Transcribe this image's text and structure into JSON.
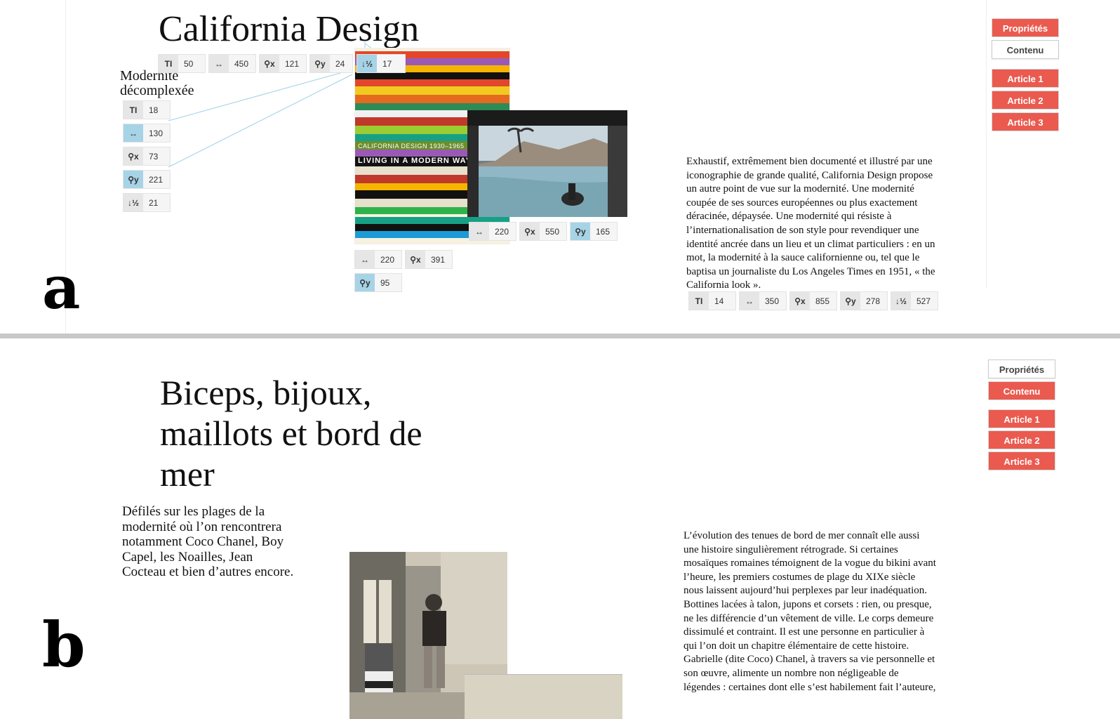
{
  "colors": {
    "accent": "#ea5a4f",
    "chip_active": "#a7d3e7"
  },
  "icons": {
    "size": "font-size-icon",
    "width": "width-icon",
    "x": "pin-x-icon",
    "y": "pin-y-icon",
    "z": "z-order-icon"
  },
  "panel_a": {
    "letter": "a",
    "title": "California Design",
    "subtitle_line1": "Modernité",
    "subtitle_line2": "décomplexée",
    "body": "Exhaustif, extrêmement bien documenté et illustré par une iconographie de grande qualité, California Design propose un autre point de vue sur la modernité. Une modernité coupée de ses sources européennes ou plus exactement déracinée, dépaysée. Une modernité qui résiste à l’internationalisation de son style pour revendiquer une identité ancrée dans un lieu et un climat particuliers : en un mot, la modernité à la sauce californienne ou, tel que le baptisa un journaliste du Los Angeles Times en 1951, « the California look ».",
    "book_text_line1": "CALIFORNIA DESIGN   1930–1965",
    "book_text_line2": "LIVING IN A MODERN WAY",
    "menu": {
      "proprietes": "Propriétés",
      "contenu": "Contenu",
      "article1": "Article 1",
      "article2": "Article 2",
      "article3": "Article 3"
    },
    "title_chips": {
      "size": "50",
      "width": "450",
      "x": "121",
      "y": "24",
      "z": "17"
    },
    "subtitle_chips": {
      "size": "18",
      "width": "130",
      "x": "73",
      "y": "221",
      "z": "21"
    },
    "photo_chips": {
      "width": "220",
      "x": "550",
      "y": "165"
    },
    "book_chips": {
      "width": "220",
      "x": "391",
      "y": "95"
    },
    "body_chips": {
      "size": "14",
      "width": "350",
      "x": "855",
      "y": "278",
      "z": "527"
    }
  },
  "panel_b": {
    "letter": "b",
    "title_line1": "Biceps, bijoux,",
    "title_line2": "maillots et bord de",
    "title_line3": "mer",
    "subtitle_line1": "Défilés sur les plages de la",
    "subtitle_line2": "modernité où l’on rencontrera",
    "subtitle_line3": "notamment Coco Chanel, Boy",
    "subtitle_line4": "Capel, les Noailles, Jean",
    "subtitle_line5": "Cocteau et bien d’autres encore.",
    "body": "L’évolution des tenues de bord de mer connaît elle aussi une histoire singulièrement rétrograde. Si certaines mosaïques romaines témoignent de la vogue du bikini avant l’heure, les premiers costumes de plage du XIXe siècle nous laissent aujourd’hui perplexes par leur inadéquation. Bottines lacées à talon, jupons et corsets : rien, ou presque, ne les différencie d’un vêtement de ville. Le corps demeure dissimulé et contraint. Il est une personne en particulier à qui l’on doit un chapitre élémentaire de cette histoire. Gabrielle (dite Coco) Chanel, à travers sa vie personnelle et son œuvre, alimente un nombre non négligeable de légendes : certaines dont elle s’est habilement fait l’auteure,",
    "menu": {
      "proprietes": "Propriétés",
      "contenu": "Contenu",
      "article1": "Article 1",
      "article2": "Article 2",
      "article3": "Article 3"
    }
  }
}
